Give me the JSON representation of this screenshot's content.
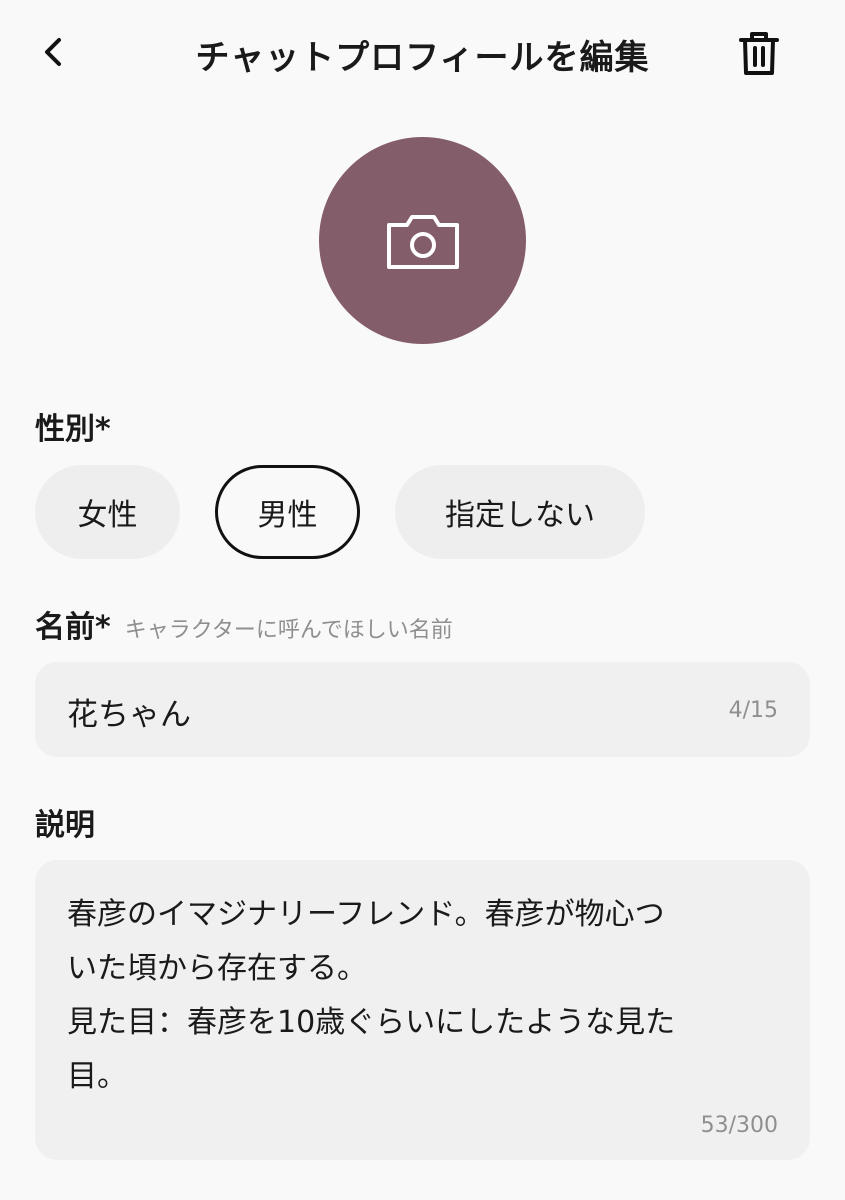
{
  "header": {
    "title": "チャットプロフィールを編集",
    "back_icon": "chevron-left-icon",
    "delete_icon": "trash-icon"
  },
  "avatar": {
    "icon": "camera-icon",
    "color": "#845d6a"
  },
  "gender": {
    "label": "性別*",
    "options": [
      {
        "label": "女性",
        "selected": false
      },
      {
        "label": "男性",
        "selected": true
      },
      {
        "label": "指定しない",
        "selected": false
      }
    ]
  },
  "name": {
    "label": "名前*",
    "hint": "キャラクターに呼んでほしい名前",
    "value": "花ちゃん",
    "counter": "4/15"
  },
  "description": {
    "label": "説明",
    "value": "春彦のイマジナリーフレンド。春彦が物心つ\nいた頃から存在する。\n見た目：春彦を10歳ぐらいにしたような見た\n目。",
    "counter": "53/300"
  }
}
